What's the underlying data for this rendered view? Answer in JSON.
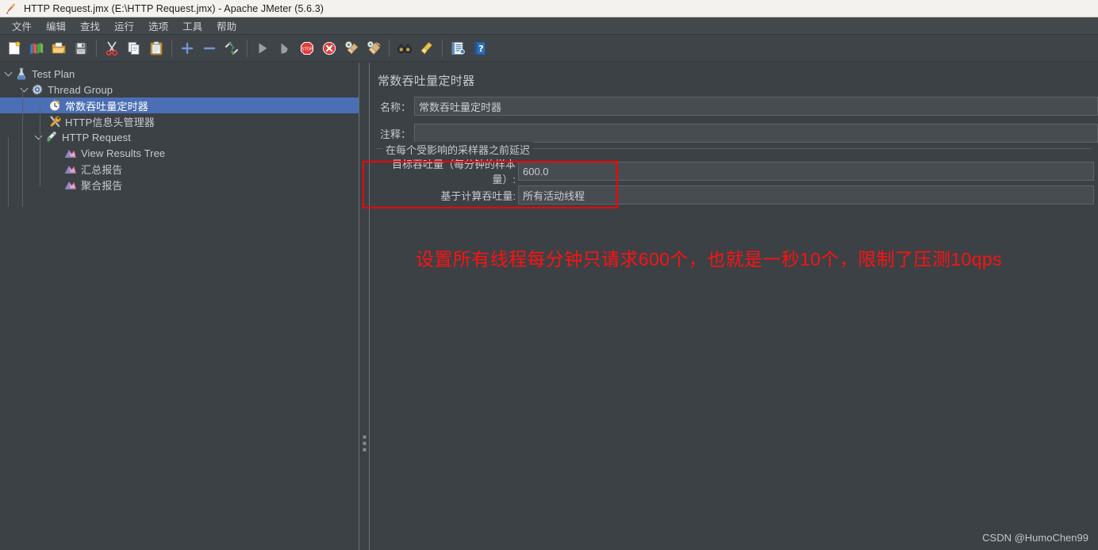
{
  "window": {
    "title": "HTTP Request.jmx (E:\\HTTP Request.jmx) - Apache JMeter (5.6.3)",
    "icon": "jmeter-feather-icon"
  },
  "menubar": {
    "items": [
      {
        "label": "文件",
        "name": "menu-file"
      },
      {
        "label": "编辑",
        "name": "menu-edit"
      },
      {
        "label": "查找",
        "name": "menu-search"
      },
      {
        "label": "运行",
        "name": "menu-run"
      },
      {
        "label": "选项",
        "name": "menu-options"
      },
      {
        "label": "工具",
        "name": "menu-tools"
      },
      {
        "label": "帮助",
        "name": "menu-help"
      }
    ]
  },
  "toolbar": {
    "buttons": [
      {
        "icon": "new-document-icon",
        "name": "toolbar-new"
      },
      {
        "icon": "templates-icon",
        "name": "toolbar-templates"
      },
      {
        "icon": "open-folder-icon",
        "name": "toolbar-open"
      },
      {
        "icon": "save-floppy-icon",
        "name": "toolbar-save"
      },
      {
        "sep": true
      },
      {
        "icon": "scissors-cut-icon",
        "name": "toolbar-cut"
      },
      {
        "icon": "copy-icon",
        "name": "toolbar-copy"
      },
      {
        "icon": "paste-clipboard-icon",
        "name": "toolbar-paste"
      },
      {
        "sep": true
      },
      {
        "icon": "plus-expand-icon",
        "name": "toolbar-expand-all"
      },
      {
        "icon": "minus-collapse-icon",
        "name": "toolbar-collapse-all"
      },
      {
        "icon": "toggle-element-icon",
        "name": "toolbar-toggle"
      },
      {
        "sep": true
      },
      {
        "icon": "play-start-icon",
        "name": "toolbar-start"
      },
      {
        "icon": "play-no-timers-icon",
        "name": "toolbar-start-no-pauses"
      },
      {
        "icon": "stop-sign-icon",
        "name": "toolbar-stop"
      },
      {
        "icon": "shutdown-x-icon",
        "name": "toolbar-shutdown"
      },
      {
        "icon": "clear-broom-icon",
        "name": "toolbar-clear"
      },
      {
        "icon": "clear-all-broom-icon",
        "name": "toolbar-clear-all"
      },
      {
        "sep": true
      },
      {
        "icon": "binoculars-search-icon",
        "name": "toolbar-search"
      },
      {
        "icon": "reset-search-broom-icon",
        "name": "toolbar-reset-search"
      },
      {
        "sep": true
      },
      {
        "icon": "function-helper-icon",
        "name": "toolbar-function-helper"
      },
      {
        "icon": "help-book-icon",
        "name": "toolbar-help"
      }
    ]
  },
  "tree": {
    "nodes": [
      {
        "label": "Test Plan",
        "icon": "test-plan-flask-icon",
        "depth": 0,
        "toggle": "expanded",
        "selected": false,
        "name": "tree-node-test-plan"
      },
      {
        "label": "Thread Group",
        "icon": "thread-group-gear-icon",
        "depth": 1,
        "toggle": "expanded",
        "selected": false,
        "name": "tree-node-thread-group"
      },
      {
        "label": "常数吞吐量定时器",
        "icon": "timer-clock-icon",
        "depth": 2,
        "toggle": "none",
        "selected": true,
        "name": "tree-node-constant-throughput-timer"
      },
      {
        "label": "HTTP信息头管理器",
        "icon": "header-manager-tools-icon",
        "depth": 2,
        "toggle": "none",
        "selected": false,
        "name": "tree-node-http-header-manager"
      },
      {
        "label": "HTTP Request",
        "icon": "http-request-pipette-icon",
        "depth": 2,
        "toggle": "expanded",
        "selected": false,
        "name": "tree-node-http-request"
      },
      {
        "label": "View Results Tree",
        "icon": "listener-chart-icon",
        "depth": 3,
        "toggle": "none",
        "selected": false,
        "name": "tree-node-view-results-tree"
      },
      {
        "label": "汇总报告",
        "icon": "listener-chart-icon",
        "depth": 3,
        "toggle": "none",
        "selected": false,
        "name": "tree-node-summary-report"
      },
      {
        "label": "聚合报告",
        "icon": "listener-chart-icon",
        "depth": 3,
        "toggle": "none",
        "selected": false,
        "name": "tree-node-aggregate-report"
      }
    ]
  },
  "panel": {
    "title": "常数吞吐量定时器",
    "name_label": "名称：",
    "name_value": "常数吞吐量定时器",
    "comment_label": "注释：",
    "comment_value": "",
    "group_title": "在每个受影响的采样器之前延迟",
    "throughput_label": "目标吞吐量（每分钟的样本量）:",
    "throughput_value": "600.0",
    "calc_mode_label": "基于计算吞吐量:",
    "calc_mode_value": "所有活动线程"
  },
  "annotation": {
    "text": "设置所有线程每分钟只请求600个，也就是一秒10个，限制了压测10qps",
    "color": "#ff1111"
  },
  "watermark": {
    "text": "CSDN @HumoChen99"
  },
  "colors": {
    "background": "#3c4145",
    "titlebar": "#f4f2ef",
    "menubar": "#43484c",
    "selection": "#4a6fb5",
    "text": "#c7cacd",
    "highlight_border": "#ff0000"
  }
}
